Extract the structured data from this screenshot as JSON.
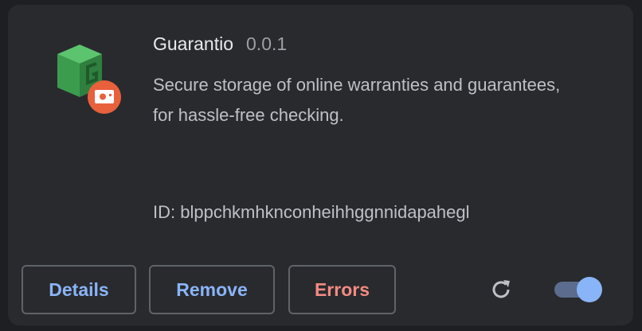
{
  "extension": {
    "name": "Guarantio",
    "version": "0.0.1",
    "description": "Secure storage of online warranties and guarantees, for hassle-free checking.",
    "id_text": "ID: blppchkmhknconheihhggnnidapahegl",
    "icon": "green-cube-icon",
    "badge_icon": "policy-badge-icon"
  },
  "buttons": {
    "details": "Details",
    "remove": "Remove",
    "errors": "Errors"
  },
  "controls": {
    "reload_icon": "reload-icon",
    "enabled": true
  },
  "colors": {
    "accent": "#8ab4f8",
    "error": "#f28b82",
    "card_bg": "#292a2d",
    "cube_green": "#34a853",
    "badge_orange": "#e8603c"
  }
}
